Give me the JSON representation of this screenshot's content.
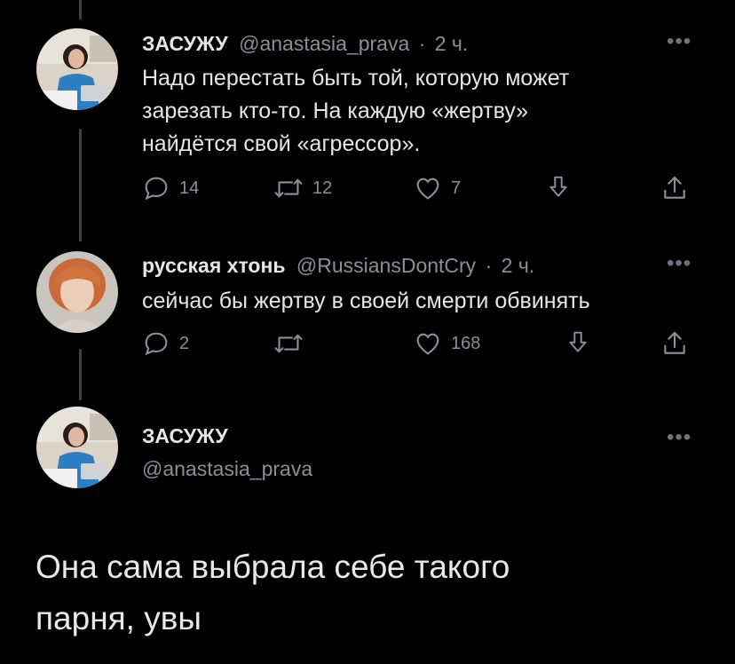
{
  "tweets": [
    {
      "name": "ЗАСУЖУ",
      "handle": "@anastasia_prava",
      "sep": "·",
      "time": "2 ч.",
      "text_lines": [
        "Надо перестать быть той, которую может",
        "зарезать кто-то. На каждую «жертву»",
        "найдётся свой «агрессор»."
      ],
      "replies": "14",
      "retweets": "12",
      "likes": "7"
    },
    {
      "name": "русская хтонь",
      "handle": "@RussiansDontCry",
      "sep": "·",
      "time": "2 ч.",
      "text_lines": [
        "сейчас бы жертву в своей смерти обвинять"
      ],
      "replies": "2",
      "retweets": "",
      "likes": "168"
    }
  ],
  "main_tweet": {
    "name": "ЗАСУЖУ",
    "handle": "@anastasia_prava",
    "text_lines": [
      "Она сама выбрала себе такого",
      "парня, увы"
    ]
  },
  "icons": {
    "reply": "reply-icon",
    "retweet": "retweet-icon",
    "like": "heart-icon",
    "bookmark": "bookmark-icon",
    "share": "share-icon",
    "more": "more-icon"
  },
  "colors": {
    "background": "#000000",
    "text": "#e6e6e6",
    "muted": "#8b8f93",
    "thread": "#3d4145"
  }
}
